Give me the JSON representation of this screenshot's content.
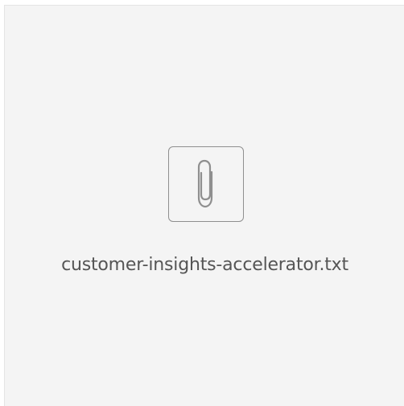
{
  "attachment": {
    "icon": "paperclip-icon",
    "file_name": "customer-insights-accelerator.txt",
    "colors": {
      "background": "#f4f4f4",
      "icon_stroke": "#8f8f8f",
      "text": "#555555"
    }
  }
}
